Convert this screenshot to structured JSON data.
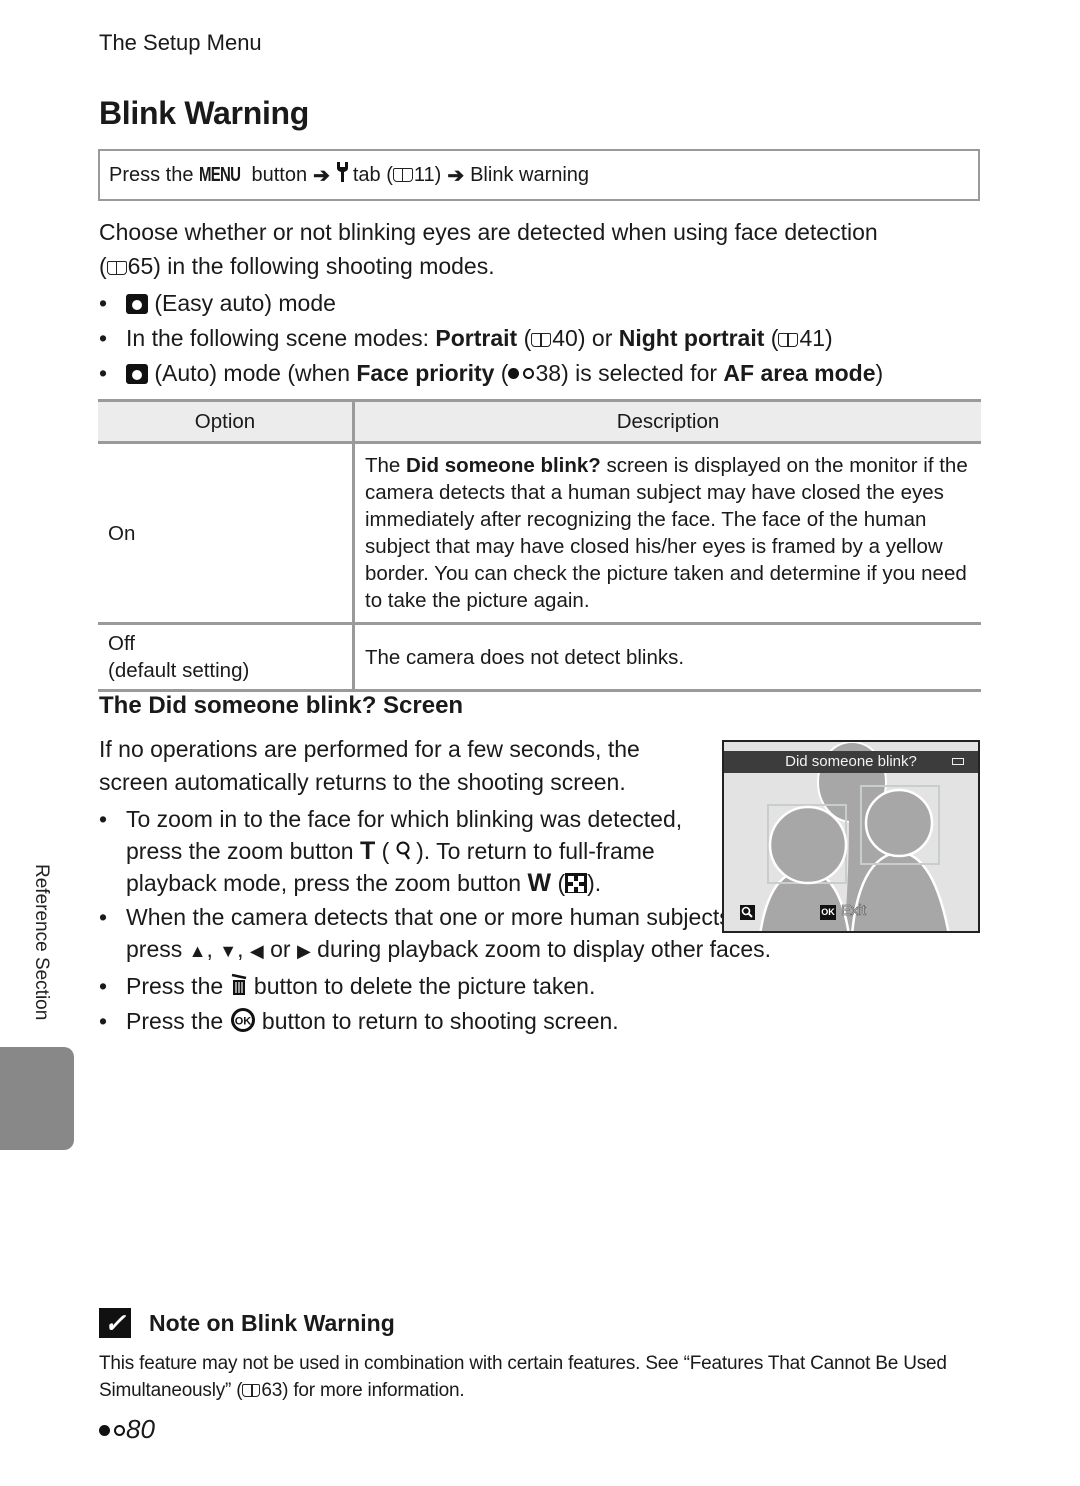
{
  "header": {
    "section": "The Setup Menu"
  },
  "title": "Blink Warning",
  "path": {
    "prefix": "Press the",
    "menu_key": "MENU",
    "button_word": "button",
    "arrow": "➔",
    "tab_icon": "wrench-icon",
    "tab_text": "tab (",
    "tab_ref": "11)",
    "target": "Blink warning"
  },
  "intro": {
    "line1": "Choose whether or not blinking eyes are detected when using face detection",
    "line2_open": "(",
    "line2_ref": "65) in the following shooting modes."
  },
  "modes": [
    {
      "icon": "easy-auto-icon",
      "text": " (Easy auto) mode"
    },
    {
      "pre": "In the following scene modes: ",
      "b1": "Portrait",
      "r1_open": " (",
      "r1": "40) or ",
      "b2": "Night portrait",
      "r2_open": " (",
      "r2": "41)"
    },
    {
      "icon": "auto-mode-icon",
      "pre": " (Auto) mode (when ",
      "b1": "Face priority",
      "r1_open": " (",
      "r1": "38) is selected for ",
      "b2": "AF area mode",
      "close": ")"
    }
  ],
  "table": {
    "headers": [
      "Option",
      "Description"
    ],
    "rows": [
      {
        "option": "On",
        "desc_pre": "The ",
        "desc_bold": "Did someone blink?",
        "desc_post": " screen is displayed on the monitor if the camera detects that a human subject may have closed the eyes immediately after recognizing the face. The face of the human subject that may have closed his/her eyes is framed by a yellow border. You can check the picture taken and determine if you need to take the picture again."
      },
      {
        "option": "Off",
        "option_sub": "(default setting)",
        "desc": "The camera does not detect blinks."
      }
    ]
  },
  "screen_section": {
    "heading": "The Did someone blink? Screen",
    "paragraph": "If no operations are performed for a few seconds, the screen automatically returns to the shooting screen.",
    "bullets": [
      {
        "t1": "To zoom in to the face for which blinking was detected, press the zoom button ",
        "k1": "T",
        "t2": " (",
        "t3": "). To return to full-frame playback mode, press the zoom button ",
        "k2": "W",
        "t4": " (",
        "t5": ")."
      },
      {
        "t1": "When the camera detects that one or more human subjects have closed their eyes, press ",
        "up": "▲",
        "c1": ", ",
        "down": "▼",
        "c2": ", ",
        "left": "◀",
        "or": " or ",
        "right": "▶",
        "t2": " during playback zoom to display other faces."
      },
      {
        "t1": "Press the ",
        "icon": "trash-icon",
        "t2": " button to delete the picture taken."
      },
      {
        "t1": "Press the ",
        "icon": "ok-icon",
        "t2": " button to return to shooting screen."
      }
    ],
    "camera_screen": {
      "title": "Did someone blink?",
      "zoom_key": "🔍",
      "ok_key": "OK",
      "exit_label": "Exit"
    }
  },
  "side_label": "Reference Section",
  "note": {
    "check": "✓",
    "heading": "Note on Blink Warning",
    "body_pre": "This feature may not be used in combination with certain features. See “Features That Cannot Be Used Simultaneously” (",
    "body_ref": "63) for more information."
  },
  "page_number": "80",
  "colors": {
    "rule": "#9a9a9a",
    "header_bg": "#ececec",
    "tab": "#888888",
    "screen_bar": "#3c3c3c"
  }
}
